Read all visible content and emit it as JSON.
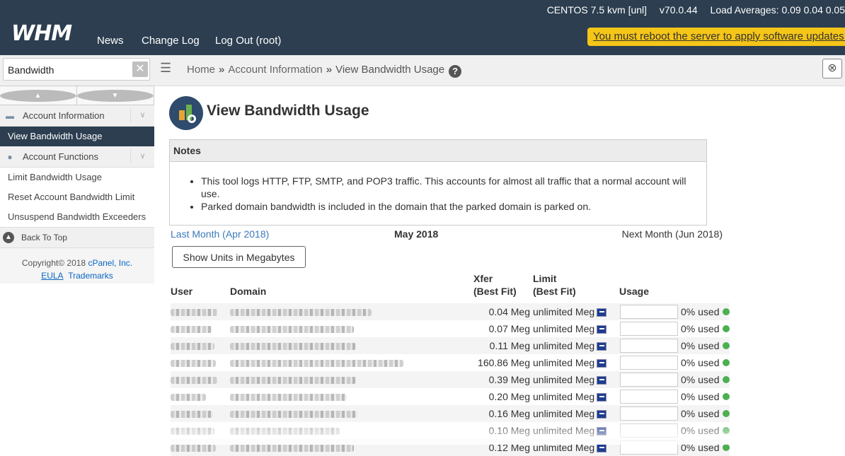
{
  "topbar": {
    "os": "CENTOS 7.5 kvm [unl]",
    "version": "v70.0.44",
    "load": "Load Averages: 0.09 0.04 0.05",
    "logo": "WHM",
    "nav": [
      "News",
      "Change Log",
      "Log Out (root)"
    ],
    "reboot_notice": "You must reboot the server to apply software updates."
  },
  "search": {
    "value": "Bandwidth"
  },
  "breadcrumb": {
    "home": "Home",
    "section": "Account Information",
    "current": "View Bandwidth Usage",
    "help": "?"
  },
  "sidebar": {
    "groups": [
      {
        "label": "Account Information",
        "icon": "id-card-icon",
        "items": [
          "View Bandwidth Usage"
        ],
        "active": "View Bandwidth Usage"
      },
      {
        "label": "Account Functions",
        "icon": "user-icon",
        "items": [
          "Limit Bandwidth Usage",
          "Reset Account Bandwidth Limit",
          "Unsuspend Bandwidth Exceeders"
        ]
      }
    ],
    "back_to_top": "Back To Top",
    "copyright_prefix": "Copyright© 2018",
    "copyright_link": "cPanel, Inc.",
    "eula": "EULA",
    "trademarks": "Trademarks"
  },
  "main": {
    "title": "View Bandwidth Usage",
    "notes_title": "Notes",
    "notes": [
      "This tool logs HTTP, FTP, SMTP, and POP3 traffic. This accounts for almost all traffic that a normal account will use.",
      "Parked domain bandwidth is included in the domain that the parked domain is parked on."
    ],
    "prev_month": "Last Month (Apr 2018)",
    "current_month": "May 2018",
    "next_month": "Next Month (Jun 2018)",
    "units_button": "Show Units in Megabytes",
    "columns": {
      "user": "User",
      "domain": "Domain",
      "xfer1": "Xfer",
      "xfer2": "(Best Fit)",
      "limit1": "Limit",
      "limit2": "(Best Fit)",
      "usage": "Usage"
    },
    "rows": [
      {
        "xfer": "0.04 Meg",
        "limit": "unlimited Meg",
        "usage": "0% used"
      },
      {
        "xfer": "0.07 Meg",
        "limit": "unlimited Meg",
        "usage": "0% used"
      },
      {
        "xfer": "0.11 Meg",
        "limit": "unlimited Meg",
        "usage": "0% used"
      },
      {
        "xfer": "160.86 Meg",
        "limit": "unlimited Meg",
        "usage": "0% used"
      },
      {
        "xfer": "0.39 Meg",
        "limit": "unlimited Meg",
        "usage": "0% used"
      },
      {
        "xfer": "0.20 Meg",
        "limit": "unlimited Meg",
        "usage": "0% used"
      },
      {
        "xfer": "0.16 Meg",
        "limit": "unlimited Meg",
        "usage": "0% used"
      },
      {
        "xfer": "0.10 Meg",
        "limit": "unlimited Meg",
        "usage": "0% used"
      },
      {
        "xfer": "0.12 Meg",
        "limit": "unlimited Meg",
        "usage": "0% used"
      }
    ]
  },
  "colors": {
    "topbar": "#2c3e50",
    "reboot": "#f5c518",
    "link": "#3c7ab8",
    "ok": "#4caf50"
  }
}
